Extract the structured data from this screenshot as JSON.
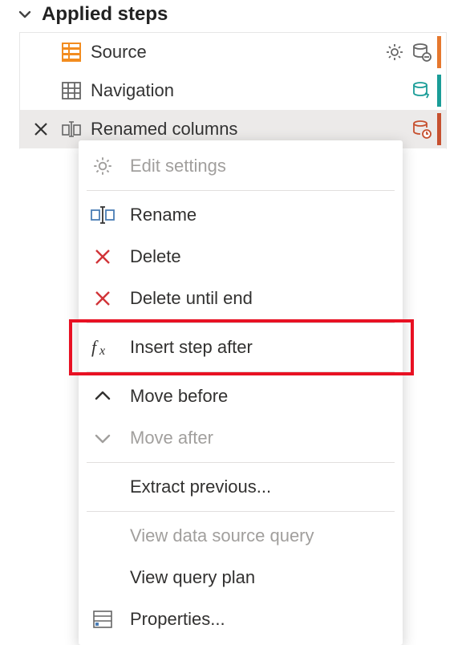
{
  "panel": {
    "title": "Applied steps"
  },
  "steps": [
    {
      "label": "Source"
    },
    {
      "label": "Navigation"
    },
    {
      "label": "Renamed columns"
    }
  ],
  "menu": {
    "edit_settings": "Edit settings",
    "rename": "Rename",
    "delete": "Delete",
    "delete_until_end": "Delete until end",
    "insert_step_after": "Insert step after",
    "move_before": "Move before",
    "move_after": "Move after",
    "extract_previous": "Extract previous...",
    "view_data_source_query": "View data source query",
    "view_query_plan": "View query plan",
    "properties": "Properties..."
  }
}
